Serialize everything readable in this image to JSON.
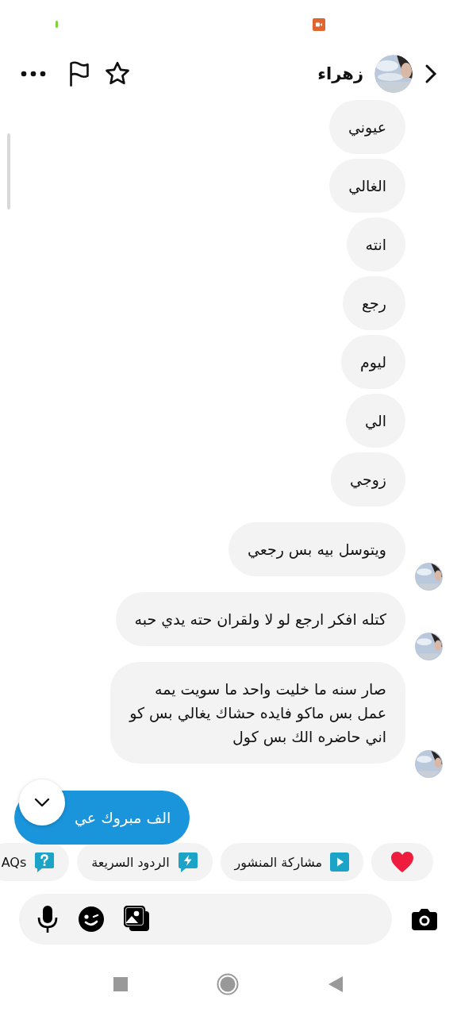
{
  "header": {
    "name": "زهراء"
  },
  "messages": [
    {
      "text": "عيوني",
      "avatar": false
    },
    {
      "text": "الغالي",
      "avatar": false
    },
    {
      "text": "انته",
      "avatar": false
    },
    {
      "text": "رجع",
      "avatar": false
    },
    {
      "text": "ليوم",
      "avatar": false
    },
    {
      "text": "الي",
      "avatar": false
    },
    {
      "text": "زوجي",
      "avatar": false
    },
    {
      "text": "ويتوسل بيه بس رجعي",
      "avatar": true
    },
    {
      "text": "كتله افكر ارجع لو لا ولقران حته يدي حبه",
      "avatar": true
    },
    {
      "text": "صار سنه ما خليت واحد ما سويت يمه\nعمل بس ماكو فايده حشاك يغالي بس كو\nاني حاضره الك بس كول",
      "avatar": true
    }
  ],
  "sent": {
    "text": "الف مبروك عي"
  },
  "chips": [
    {
      "kind": "heart"
    },
    {
      "kind": "play",
      "label": "مشاركة المنشور"
    },
    {
      "kind": "bolt",
      "label": "الردود السريعة"
    },
    {
      "kind": "question",
      "label": "AQs"
    }
  ]
}
